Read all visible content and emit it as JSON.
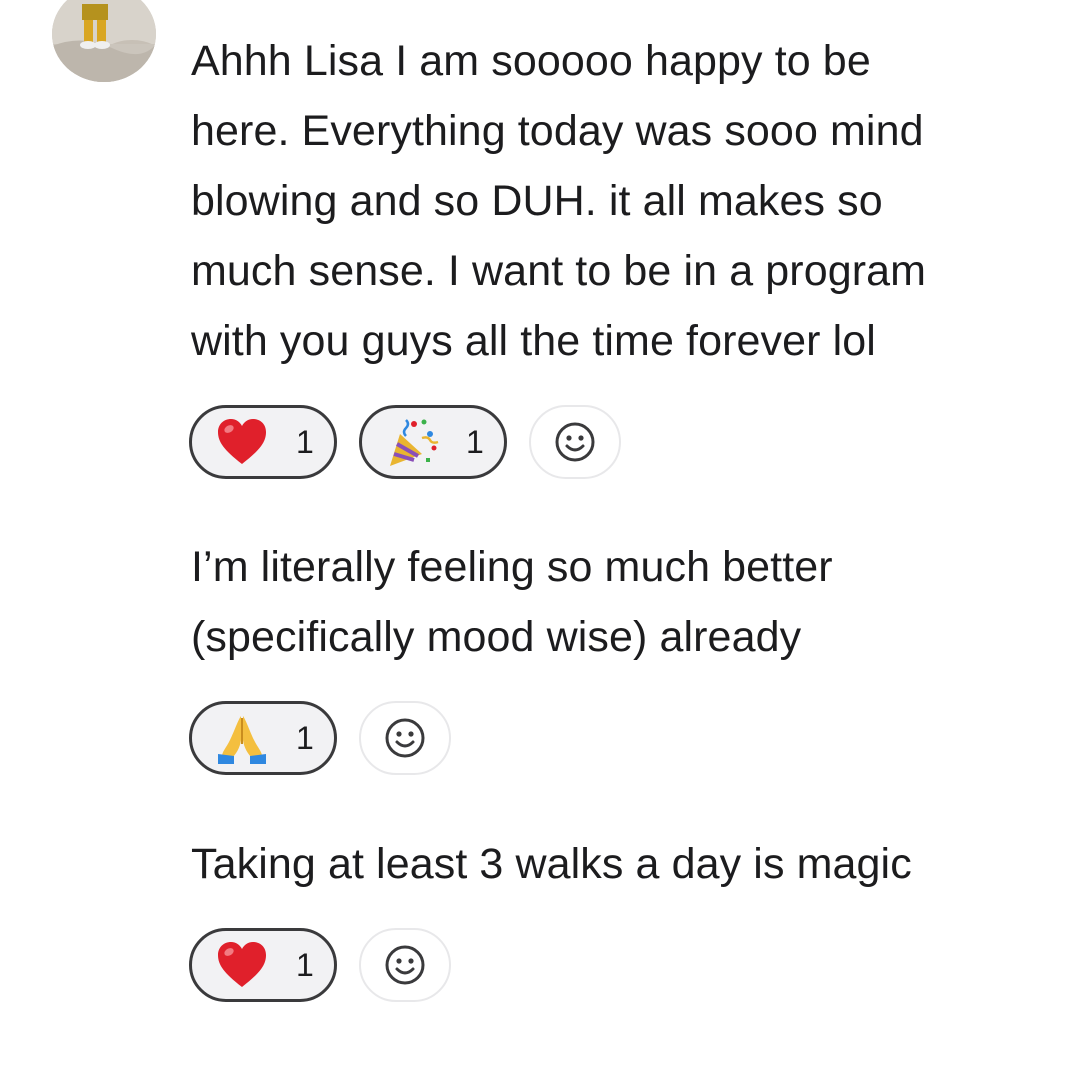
{
  "messages": [
    {
      "text": "Ahhh Lisa I am sooooo happy to be\nhere. Everything today was sooo mind\nblowing and so DUH. it all makes so\nmuch sense. I want to be in a program\nwith you guys all the time forever lol",
      "reactions": [
        {
          "icon": "red-heart-emoji",
          "count": "1"
        },
        {
          "icon": "party-popper-emoji",
          "count": "1"
        }
      ]
    },
    {
      "text": "I’m literally feeling so much better\n(specifically mood wise) already",
      "reactions": [
        {
          "icon": "folded-hands-emoji",
          "count": "1"
        }
      ]
    },
    {
      "text": "Taking at least 3 walks a day is magic",
      "reactions": [
        {
          "icon": "red-heart-emoji",
          "count": "1"
        }
      ]
    }
  ],
  "add_reaction_icon": "smiley-face-icon",
  "colors": {
    "text": "#1c1c1e",
    "pill_border": "#3a3a3c",
    "pill_background": "#f2f2f4",
    "add_button_border": "#e8e8ea",
    "heart": "#e0202b"
  }
}
